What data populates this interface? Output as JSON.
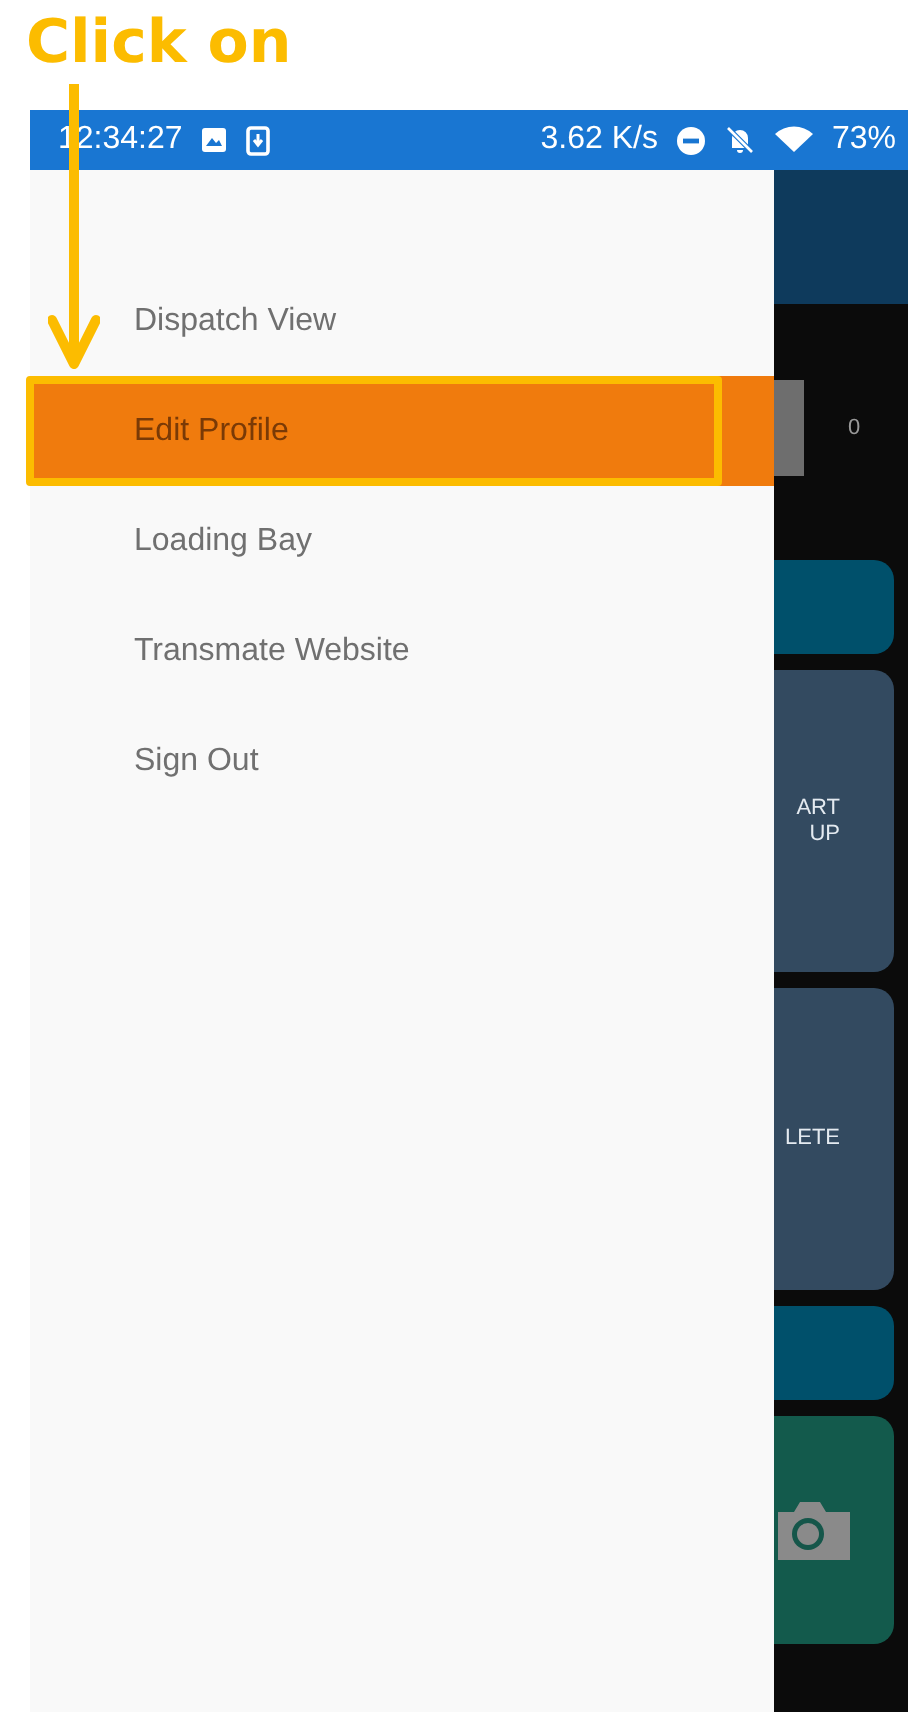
{
  "annotation": {
    "label": "Click on"
  },
  "status_bar": {
    "time": "12:34:27",
    "speed": "3.62 K/s",
    "battery": "73%"
  },
  "drawer": {
    "items": [
      {
        "label": "Dispatch View",
        "selected": false
      },
      {
        "label": "Edit Profile",
        "selected": true
      },
      {
        "label": "Loading Bay",
        "selected": false
      },
      {
        "label": "Transmate Website",
        "selected": false
      },
      {
        "label": "Sign Out",
        "selected": false
      }
    ]
  },
  "background": {
    "counter": "0",
    "cards": [
      {
        "kind": "teal"
      },
      {
        "kind": "slate",
        "lines": [
          "ART",
          "UP"
        ]
      },
      {
        "kind": "slate",
        "lines": [
          "LETE"
        ]
      },
      {
        "kind": "teal"
      },
      {
        "kind": "camera"
      }
    ]
  }
}
